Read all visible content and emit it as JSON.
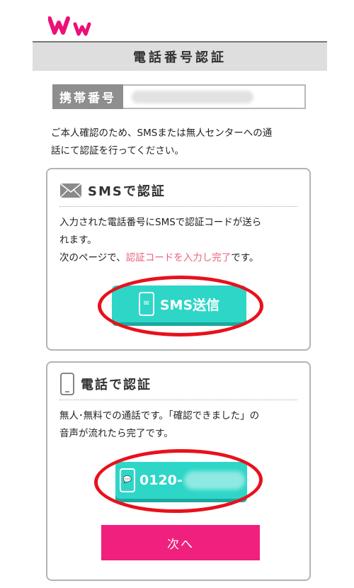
{
  "header": {
    "logo_text": "Ww",
    "page_title": "電話番号認証"
  },
  "phone": {
    "label": "携帯番号",
    "value": ""
  },
  "intro": {
    "line1": "ご本人確認のため、SMSまたは無人センターへの通",
    "line2": "話にて認証を行ってください。"
  },
  "sms_card": {
    "title": "SMSで認証",
    "icon": "envelope-icon",
    "body_line1": "入力された電話番号にSMSで認証コードが送ら",
    "body_line2": "れます。",
    "body_line3_prefix": "次のページで、",
    "body_line3_highlight": "認証コードを入力し完了",
    "body_line3_suffix": "です。",
    "button_label": "SMS送信",
    "button_icon": "phone-message-icon"
  },
  "tel_card": {
    "title": "電話で認証",
    "icon": "smartphone-icon",
    "body_line1": "無人･無料での通話です。「確認できました」の",
    "body_line2": "音声が流れたら完了です。",
    "button_number": "0120-",
    "button_icon": "phone-chat-icon",
    "next_label": "次へ"
  },
  "colors": {
    "teal": "#2ed6c8",
    "pink_button": "#f0207e",
    "highlight": "#e8637e",
    "logo": "#ec1078",
    "annotation_ring": "#e8111c"
  }
}
